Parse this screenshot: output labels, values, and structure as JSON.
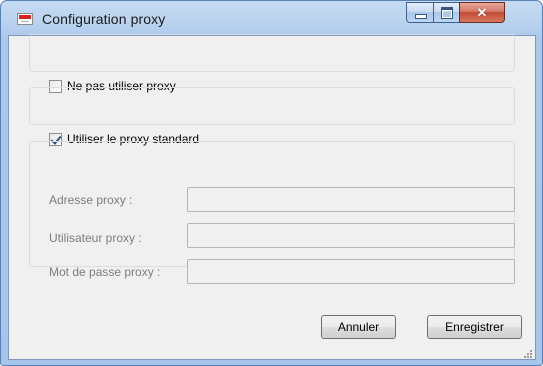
{
  "window": {
    "title": "Configuration proxy",
    "icon": "proxy-config-app-icon",
    "caption_buttons": [
      {
        "name": "minimize",
        "icon": "minimize-icon"
      },
      {
        "name": "maximize",
        "icon": "maximize-icon"
      },
      {
        "name": "close",
        "icon": "close-icon"
      }
    ]
  },
  "options": {
    "no_proxy": {
      "label": "Ne pas utiliser proxy",
      "checked": false
    },
    "standard_proxy": {
      "label": "Utiliser le proxy standard",
      "checked": true
    }
  },
  "fields": {
    "address": {
      "label": "Adresse proxy :",
      "value": "",
      "disabled": true
    },
    "user": {
      "label": "Utilisateur proxy :",
      "value": "",
      "disabled": true
    },
    "password": {
      "label": "Mot de passe proxy :",
      "value": "",
      "disabled": true
    }
  },
  "buttons": {
    "cancel": "Annuler",
    "save": "Enregistrer"
  },
  "colors": {
    "window_frame": "#a6c5ea",
    "client_background": "#f0f0f0",
    "close_button": "#c24a35",
    "disabled_text": "#7d7d7d"
  }
}
